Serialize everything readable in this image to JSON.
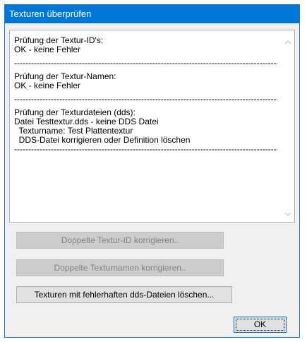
{
  "window": {
    "title": "Texturen überprüfen"
  },
  "log": {
    "sections": [
      {
        "lines": [
          "Prüfung der Textur-ID's:",
          "OK - keine Fehler"
        ]
      },
      {
        "lines": [
          "Prüfung der Textur-Namen:",
          "OK - keine Fehler"
        ]
      },
      {
        "lines": [
          "Prüfung der Texturdateien (dds):",
          "Datei Testtextur.dds - keine DDS Datei",
          "  Texturname: Test Plattentextur",
          "  DDS-Datei korrigieren oder Definition löschen"
        ]
      }
    ],
    "separator": "------------------------------------------------------------------------------------------------------------------------"
  },
  "buttons": {
    "fix_duplicate_ids": "Doppelte Textur-ID korrigieren..",
    "fix_duplicate_names": "Doppelte Texturnamen korrigieren..",
    "delete_bad_dds": "Texturen mit fehlerhaften dds-Dateien löschen...",
    "ok": "OK"
  }
}
